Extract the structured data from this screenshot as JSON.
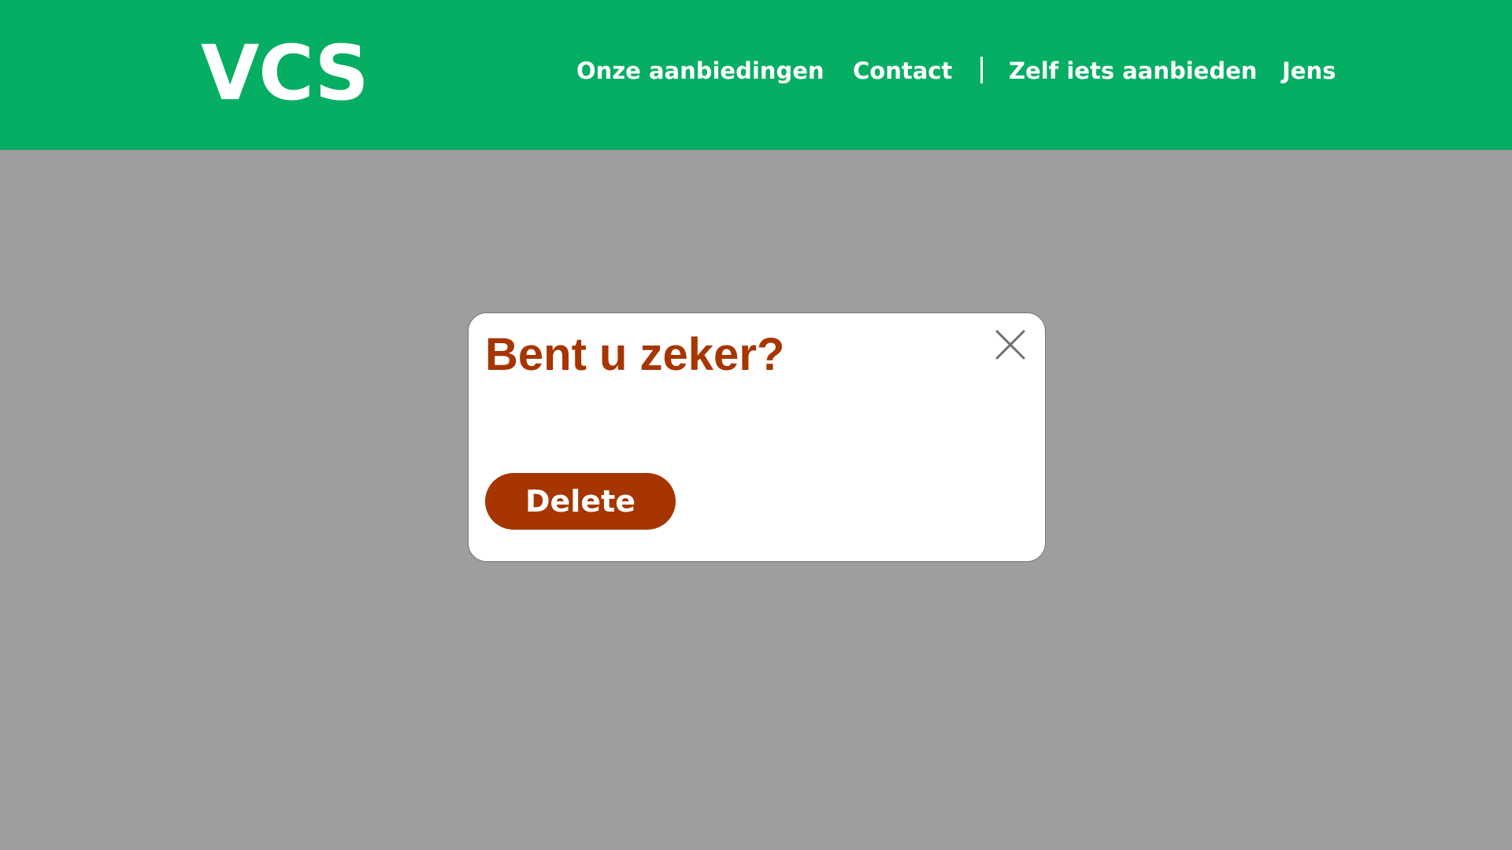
{
  "header": {
    "logo": "VCS",
    "nav": {
      "offers": "Onze aanbiedingen",
      "contact": "Contact",
      "offer_yourself": "Zelf iets aanbieden",
      "user": "Jens"
    }
  },
  "modal": {
    "title": "Bent u zeker?",
    "delete_label": "Delete",
    "close_icon": "close-icon"
  },
  "colors": {
    "header_background": "#05ae62",
    "page_overlay": "#9e9e9e",
    "accent": "#a63500",
    "modal_background": "#ffffff"
  }
}
